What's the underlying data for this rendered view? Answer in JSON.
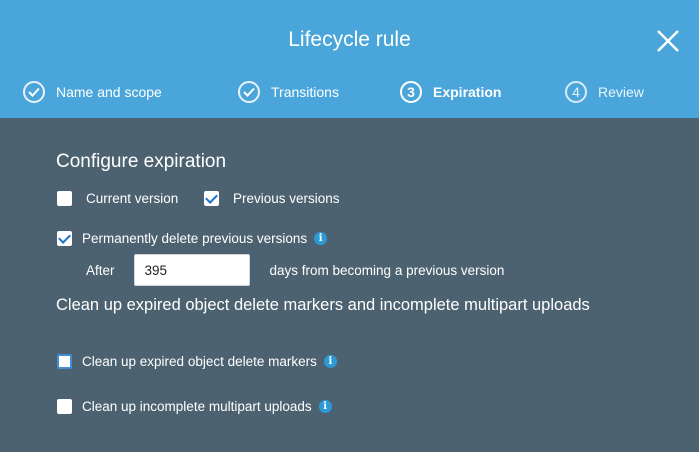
{
  "dialog": {
    "title": "Lifecycle rule"
  },
  "steps": [
    {
      "label": "Name and scope",
      "state": "done"
    },
    {
      "label": "Transitions",
      "state": "done"
    },
    {
      "label": "Expiration",
      "number": "3",
      "state": "active"
    },
    {
      "label": "Review",
      "number": "4",
      "state": "future"
    }
  ],
  "expiration": {
    "heading": "Configure expiration",
    "current_version": {
      "label": "Current version",
      "checked": false
    },
    "previous_versions": {
      "label": "Previous versions",
      "checked": true
    },
    "permanently_delete": {
      "label": "Permanently delete previous versions",
      "checked": true
    },
    "after_label": "After",
    "days_value": "395",
    "days_suffix": "days from becoming a previous version"
  },
  "cleanup": {
    "heading": "Clean up expired object delete markers and incomplete multipart uploads",
    "delete_markers": {
      "label": "Clean up expired object delete markers",
      "checked": false
    },
    "multipart": {
      "label": "Clean up incomplete multipart uploads",
      "checked": false
    }
  },
  "colors": {
    "header": "#4aa6da",
    "body": "#4d6270",
    "info": "#2d9ad8"
  }
}
